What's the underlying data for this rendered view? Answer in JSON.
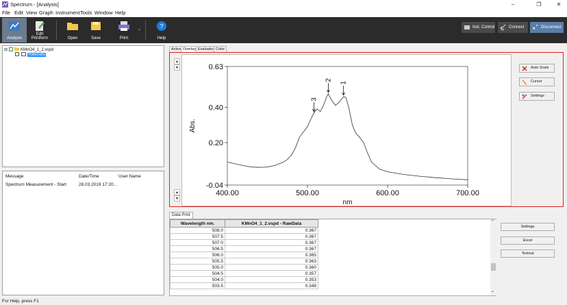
{
  "window": {
    "title": "Spectrum - [Analysis]",
    "min_icon": "minimize-icon",
    "restore_icon": "restore-icon",
    "close_icon": "close-icon"
  },
  "menu": [
    "File",
    "Edit",
    "View",
    "Graph",
    "Instrument",
    "Tools",
    "Window",
    "Help"
  ],
  "toolbar": {
    "analysis": "Analysis",
    "edit_printform": "Edit Printform",
    "open": "Open",
    "save": "Save",
    "print": "Print",
    "help": "Help",
    "inst_control": "Inst. Control",
    "connect": "Connect",
    "disconnect": "Disconnect"
  },
  "tree": {
    "file": "KMnO4_1_2.vspd",
    "node": "RawData"
  },
  "messages": {
    "headers": [
      "Message",
      "Date/Time",
      "User Name"
    ],
    "rows": [
      [
        "Spectrum Measurement - Start",
        "28.03.2019 17:20...",
        ""
      ]
    ]
  },
  "tabs": [
    "Active",
    "Overlay",
    "Evaluation",
    "Color"
  ],
  "side_buttons": {
    "auto_scale": "Auto Scale",
    "cursor": "Cursor",
    "settings": "Settings"
  },
  "chart_data": {
    "type": "line",
    "xlabel": "nm",
    "ylabel": "Abs.",
    "xlim": [
      400,
      700
    ],
    "ylim": [
      -0.04,
      0.63
    ],
    "xticks": [
      "400.00",
      "500.00",
      "600.00",
      "700.00"
    ],
    "yticks": [
      "0.63",
      "0.40",
      "0.20",
      "-0.04"
    ],
    "grid": false,
    "series": [
      {
        "x": [
          400,
          410,
          420,
          430,
          440,
          450,
          460,
          470,
          475,
          480,
          485,
          490,
          495,
          500,
          505,
          508,
          512,
          516,
          520,
          524,
          526,
          530,
          535,
          540,
          545,
          548,
          552,
          556,
          560,
          565,
          570,
          575,
          580,
          590,
          600,
          620,
          640,
          660,
          680,
          700
        ],
        "y": [
          0.09,
          0.08,
          0.07,
          0.062,
          0.06,
          0.062,
          0.072,
          0.09,
          0.105,
          0.13,
          0.17,
          0.23,
          0.26,
          0.29,
          0.34,
          0.367,
          0.39,
          0.375,
          0.41,
          0.46,
          0.475,
          0.44,
          0.41,
          0.43,
          0.46,
          0.455,
          0.39,
          0.3,
          0.255,
          0.23,
          0.2,
          0.14,
          0.09,
          0.05,
          0.035,
          0.02,
          0.01,
          0.002,
          -0.005,
          -0.01
        ]
      }
    ],
    "annotations": [
      {
        "label": "3",
        "x": 508,
        "y": 0.367
      },
      {
        "label": "2",
        "x": 526,
        "y": 0.475
      },
      {
        "label": "1",
        "x": 545,
        "y": 0.46
      }
    ]
  },
  "data_print": {
    "tab": "Data Print",
    "headers": [
      "Wavelength nm.",
      "KMnO4_1_2.vspd - RawData"
    ],
    "rows": [
      [
        "508.0",
        "0.367"
      ],
      [
        "507.5",
        "0.367"
      ],
      [
        "507.0",
        "0.367"
      ],
      [
        "506.5",
        "0.367"
      ],
      [
        "506.0",
        "0.365"
      ],
      [
        "505.5",
        "0.363"
      ],
      [
        "505.0",
        "0.360"
      ],
      [
        "504.5",
        "0.357"
      ],
      [
        "504.0",
        "0.353"
      ],
      [
        "503.5",
        "0.348"
      ]
    ],
    "buttons": {
      "settings": "Settings",
      "excel": "Excel",
      "textout": "Textout"
    }
  },
  "status": "For Help, press F1"
}
